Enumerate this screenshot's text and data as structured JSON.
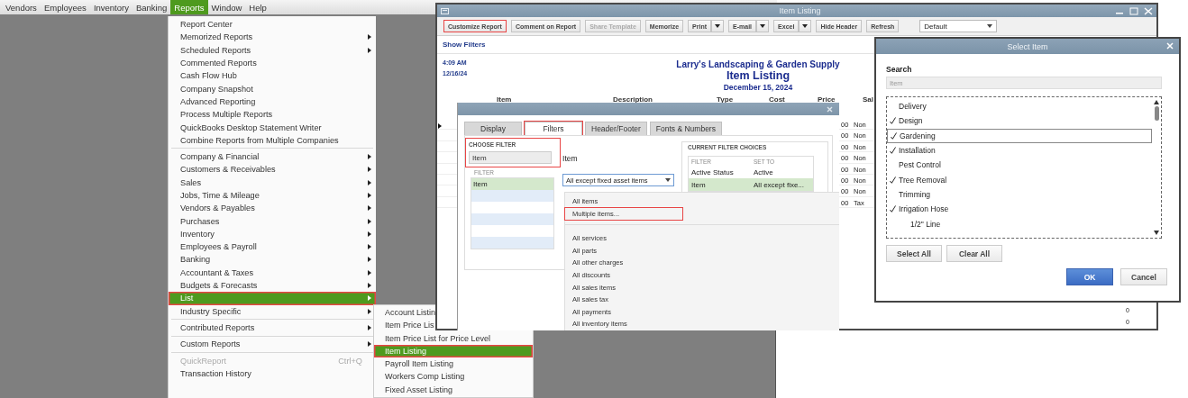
{
  "menu_bar": [
    {
      "label": "Vendors",
      "selected": false
    },
    {
      "label": "Employees",
      "selected": false
    },
    {
      "label": "Inventory",
      "selected": false
    },
    {
      "label": "Banking",
      "selected": false
    },
    {
      "label": "Reports",
      "selected": true
    },
    {
      "label": "Window",
      "selected": false
    },
    {
      "label": "Help",
      "selected": false
    }
  ],
  "reports_menu": [
    [
      {
        "label": "Report Center",
        "submenu": false,
        "selected": false,
        "disabled": false,
        "highlighted": false
      },
      {
        "label": "Memorized Reports",
        "submenu": true,
        "selected": false,
        "disabled": false,
        "highlighted": false
      },
      {
        "label": "Scheduled Reports",
        "submenu": true,
        "selected": false,
        "disabled": false,
        "highlighted": false
      },
      {
        "label": "Commented Reports",
        "submenu": false,
        "selected": false,
        "disabled": false,
        "highlighted": false
      },
      {
        "label": "Cash Flow Hub",
        "submenu": false,
        "selected": false,
        "disabled": false,
        "highlighted": false
      },
      {
        "label": "Company Snapshot",
        "submenu": false,
        "selected": false,
        "disabled": false,
        "highlighted": false
      },
      {
        "label": "Advanced Reporting",
        "submenu": false,
        "selected": false,
        "disabled": false,
        "highlighted": false
      },
      {
        "label": "Process Multiple Reports",
        "submenu": false,
        "selected": false,
        "disabled": false,
        "highlighted": false
      },
      {
        "label": "QuickBooks Desktop Statement Writer",
        "submenu": false,
        "selected": false,
        "disabled": false,
        "highlighted": false
      },
      {
        "label": "Combine Reports from Multiple Companies",
        "submenu": false,
        "selected": false,
        "disabled": false,
        "highlighted": false
      }
    ],
    [
      {
        "label": "Company & Financial",
        "submenu": true,
        "selected": false,
        "disabled": false,
        "highlighted": false
      },
      {
        "label": "Customers & Receivables",
        "submenu": true,
        "selected": false,
        "disabled": false,
        "highlighted": false
      },
      {
        "label": "Sales",
        "submenu": true,
        "selected": false,
        "disabled": false,
        "highlighted": false
      },
      {
        "label": "Jobs, Time & Mileage",
        "submenu": true,
        "selected": false,
        "disabled": false,
        "highlighted": false
      },
      {
        "label": "Vendors & Payables",
        "submenu": true,
        "selected": false,
        "disabled": false,
        "highlighted": false
      },
      {
        "label": "Purchases",
        "submenu": true,
        "selected": false,
        "disabled": false,
        "highlighted": false
      },
      {
        "label": "Inventory",
        "submenu": true,
        "selected": false,
        "disabled": false,
        "highlighted": false
      },
      {
        "label": "Employees & Payroll",
        "submenu": true,
        "selected": false,
        "disabled": false,
        "highlighted": false
      },
      {
        "label": "Banking",
        "submenu": true,
        "selected": false,
        "disabled": false,
        "highlighted": false
      },
      {
        "label": "Accountant & Taxes",
        "submenu": true,
        "selected": false,
        "disabled": false,
        "highlighted": false
      },
      {
        "label": "Budgets & Forecasts",
        "submenu": true,
        "selected": false,
        "disabled": false,
        "highlighted": false
      },
      {
        "label": "List",
        "submenu": true,
        "selected": true,
        "disabled": false,
        "highlighted": true
      },
      {
        "label": "Industry Specific",
        "submenu": true,
        "selected": false,
        "disabled": false,
        "highlighted": false
      }
    ],
    [
      {
        "label": "Contributed Reports",
        "submenu": true,
        "selected": false,
        "disabled": false,
        "highlighted": false
      }
    ],
    [
      {
        "label": "Custom Reports",
        "submenu": true,
        "selected": false,
        "disabled": false,
        "highlighted": false
      }
    ],
    [
      {
        "label": "QuickReport",
        "submenu": false,
        "selected": false,
        "disabled": true,
        "highlighted": false,
        "shortcut": "Ctrl+Q"
      },
      {
        "label": "Transaction History",
        "submenu": false,
        "selected": false,
        "disabled": false,
        "highlighted": false
      }
    ]
  ],
  "list_submenu": [
    {
      "label": "Account Listin",
      "selected": false,
      "highlighted": false
    },
    {
      "label": "Item Price Lis",
      "selected": false,
      "highlighted": false
    },
    {
      "label": "Item Price List for Price Level",
      "selected": false,
      "highlighted": false
    },
    {
      "label": "Item Listing",
      "selected": true,
      "highlighted": true
    },
    {
      "label": "Payroll Item Listing",
      "selected": false,
      "highlighted": false
    },
    {
      "label": "Workers Comp Listing",
      "selected": false,
      "highlighted": false
    },
    {
      "label": "Fixed Asset Listing",
      "selected": false,
      "highlighted": false
    }
  ],
  "report_window": {
    "title": "Item Listing",
    "toolbar": [
      {
        "label": "Customize Report",
        "kind": "button",
        "disabled": false,
        "highlighted": true
      },
      {
        "label": "Comment on Report",
        "kind": "button",
        "disabled": false,
        "highlighted": false
      },
      {
        "label": "Share Template",
        "kind": "button",
        "disabled": true,
        "highlighted": false
      },
      {
        "label": "Memorize",
        "kind": "button",
        "disabled": false,
        "highlighted": false
      },
      {
        "label": "Print",
        "kind": "split",
        "disabled": false,
        "highlighted": false
      },
      {
        "label": "E-mail",
        "kind": "split",
        "disabled": false,
        "highlighted": false
      },
      {
        "label": "Excel",
        "kind": "split",
        "disabled": false,
        "highlighted": false
      },
      {
        "label": "Hide Header",
        "kind": "button",
        "disabled": false,
        "highlighted": false
      },
      {
        "label": "Refresh",
        "kind": "button",
        "disabled": false,
        "highlighted": false
      }
    ],
    "view_select": "Default",
    "show_filters": "Show Filters",
    "time": "4:09 AM",
    "date": "12/16/24",
    "company": "Larry's Landscaping & Garden Supply",
    "report_title": "Item Listing",
    "report_date": "December 15, 2024",
    "columns": [
      "Item",
      "Description",
      "Type",
      "Cost",
      "Price",
      "Sal"
    ],
    "rows": [
      {
        "price": "00",
        "sales": "Non"
      },
      {
        "price": "00",
        "sales": "Non"
      },
      {
        "price": "00",
        "sales": "Non"
      },
      {
        "price": "00",
        "sales": "Non"
      },
      {
        "price": "00",
        "sales": "Non"
      },
      {
        "price": "00",
        "sales": "Non"
      },
      {
        "price": "00",
        "sales": "Non"
      },
      {
        "price": "00",
        "sales": "Tax"
      }
    ],
    "tail_values": [
      "0",
      "0"
    ]
  },
  "filters_dialog": {
    "tabs": [
      {
        "label": "Display",
        "selected": false,
        "highlighted": false
      },
      {
        "label": "Filters",
        "selected": true,
        "highlighted": true
      },
      {
        "label": "Header/Footer",
        "selected": false,
        "highlighted": false
      },
      {
        "label": "Fonts & Numbers",
        "selected": false,
        "highlighted": false
      }
    ],
    "choose_filter": {
      "title": "CHOOSE FILTER",
      "value": "Item",
      "highlighted": true
    },
    "filter_list": {
      "header": "FILTER",
      "items": [
        {
          "label": "Item",
          "selected": true
        }
      ]
    },
    "filter_name": "Item",
    "dropdown": {
      "value": "All except fixed asset items",
      "option_groups": [
        [
          {
            "label": "All items",
            "highlighted": false
          },
          {
            "label": "Multiple items...",
            "highlighted": true
          }
        ],
        [
          {
            "label": "All services",
            "highlighted": false
          },
          {
            "label": "All parts",
            "highlighted": false
          },
          {
            "label": "All other charges",
            "highlighted": false
          },
          {
            "label": "All discounts",
            "highlighted": false
          },
          {
            "label": "All sales items",
            "highlighted": false
          },
          {
            "label": "All sales tax",
            "highlighted": false
          },
          {
            "label": "All payments",
            "highlighted": false
          },
          {
            "label": "All inventory items",
            "highlighted": false
          }
        ]
      ]
    },
    "current_filters": {
      "title": "CURRENT FILTER CHOICES",
      "columns": [
        "FILTER",
        "SET TO"
      ],
      "rows": [
        {
          "filter": "Active Status",
          "set_to": "Active",
          "selected": false
        },
        {
          "filter": "Item",
          "set_to": "All except fixe...",
          "selected": true
        }
      ]
    }
  },
  "select_item": {
    "title": "Select Item",
    "search_label": "Search",
    "search_placeholder": "Item",
    "items": [
      {
        "label": "Delivery",
        "checked": false,
        "focused": false
      },
      {
        "label": "Design",
        "checked": true,
        "focused": false
      },
      {
        "label": "Gardening",
        "checked": true,
        "focused": true
      },
      {
        "label": "Installation",
        "checked": true,
        "focused": false
      },
      {
        "label": "Pest Control",
        "checked": false,
        "focused": false
      },
      {
        "label": "Tree Removal",
        "checked": true,
        "focused": false
      },
      {
        "label": "Trimming",
        "checked": false,
        "focused": false
      },
      {
        "label": "Irrigation Hose",
        "checked": true,
        "focused": false,
        "children": [
          {
            "label": "1/2\" Line",
            "checked": false,
            "focused": false
          }
        ]
      }
    ],
    "list_buttons": [
      "Select All",
      "Clear All"
    ],
    "dialog_buttons": [
      {
        "label": "OK",
        "primary": true
      },
      {
        "label": "Cancel",
        "primary": false
      }
    ]
  }
}
